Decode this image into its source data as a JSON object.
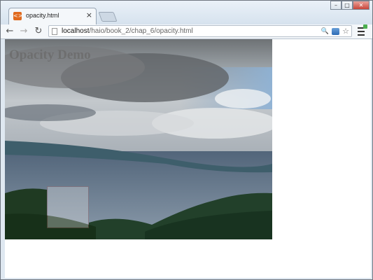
{
  "window": {
    "tab_title": "opacity.html",
    "tab_close": "×"
  },
  "toolbar": {
    "back": "←",
    "forward": "→",
    "reload": "↻",
    "url_host": "localhost",
    "url_path": "/haio/book_2/chap_6/opacity.html",
    "search_glyph": "🔍",
    "star_glyph": "☆"
  },
  "page": {
    "heading": "Opacity Demo"
  }
}
